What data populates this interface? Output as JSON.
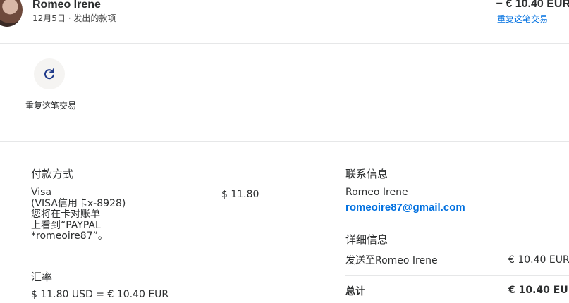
{
  "header": {
    "name": "Romeo Irene",
    "subtitle": "12月5日 · 发出的款项",
    "amount": "− € 10.40 EUR",
    "repeat_link": "重复这笔交易"
  },
  "actions": {
    "repeat_label": "重复这笔交易",
    "icon": "refresh-icon"
  },
  "payment": {
    "title": "付款方式",
    "desc_lines": [
      "Visa",
      "(VISA信用卡x-8928)",
      "您将在卡对账单",
      "上看到“PAYPAL",
      "*romeoire87”。"
    ],
    "amount": "$ 11.80"
  },
  "exchange": {
    "title": "汇率",
    "value": "$ 11.80 USD = € 10.40 EUR"
  },
  "contact": {
    "title": "联系信息",
    "name": "Romeo Irene",
    "email": "romeoire87@gmail.com"
  },
  "details": {
    "title": "详细信息",
    "sent_label": "发送至Romeo Irene",
    "sent_amount": "€ 10.40 EUR",
    "total_label": "总计",
    "total_amount": "€ 10.40 EUR"
  },
  "colors": {
    "link": "#0070e0",
    "text": "#2c2e2f",
    "divider": "#e6e7e8",
    "icon": "#1f3a8a"
  }
}
